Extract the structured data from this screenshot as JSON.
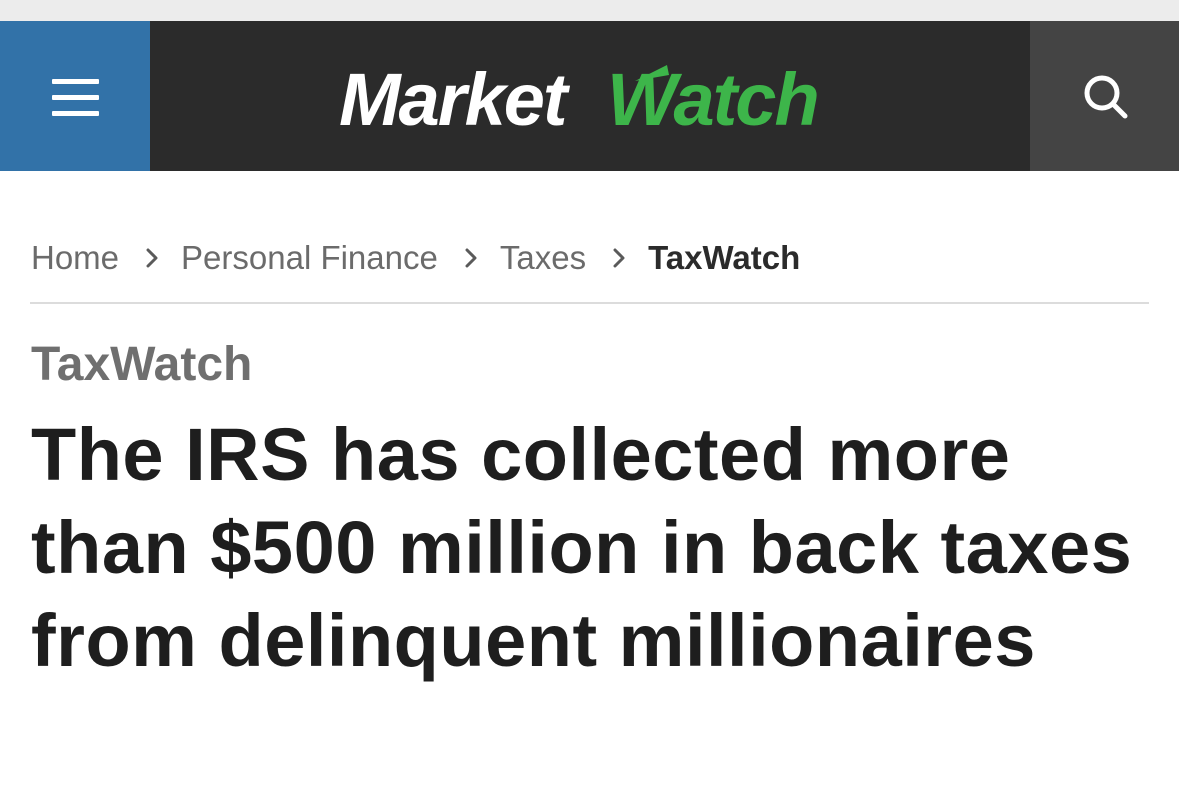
{
  "header": {
    "logo": {
      "part1": "Market",
      "part2": "Watch"
    },
    "colors": {
      "menu_bg": "#3272a8",
      "header_bg": "#2b2b2b",
      "search_bg": "#444444",
      "logo_accent": "#3db54a"
    },
    "icons": {
      "menu": "hamburger-menu-icon",
      "search": "search-icon"
    }
  },
  "breadcrumb": {
    "items": [
      "Home",
      "Personal Finance",
      "Taxes",
      "TaxWatch"
    ]
  },
  "article": {
    "category": "TaxWatch",
    "headline": "The IRS has collected more than $500 million in back taxes from delinquent millionaires"
  }
}
